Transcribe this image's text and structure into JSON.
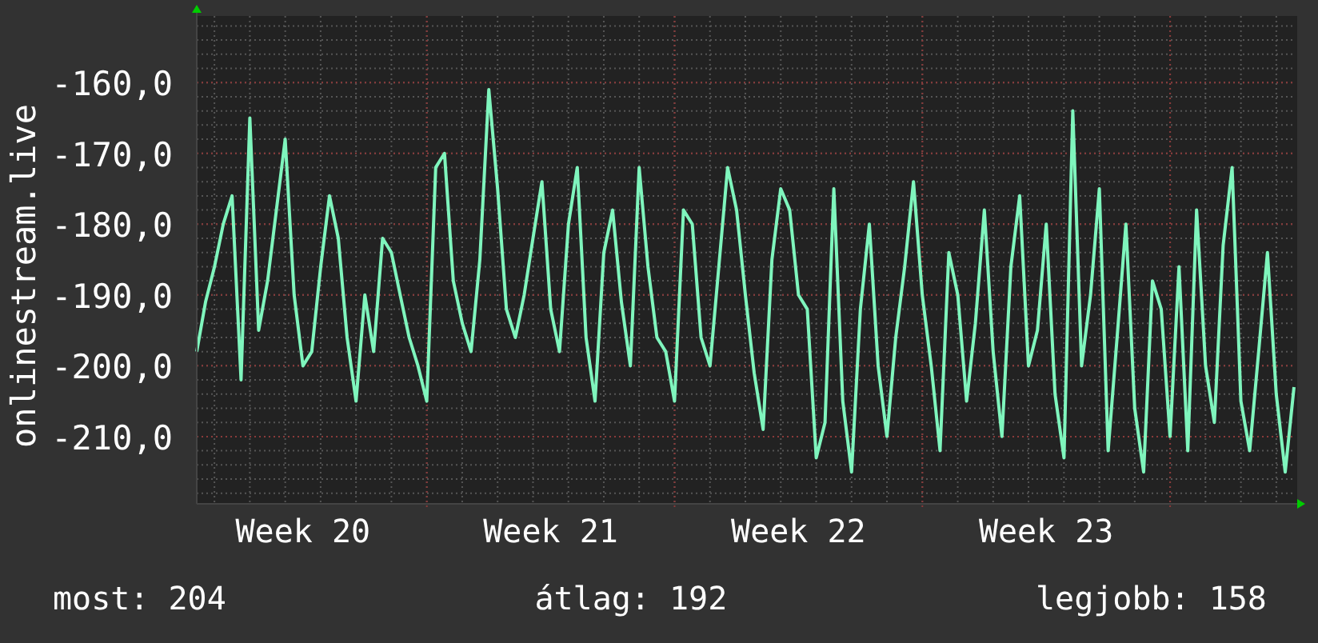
{
  "graph": {
    "chart_data": {
      "type": "line",
      "grid": true,
      "ylabel": "onlinestream.live",
      "ylim": [
        -219.5,
        -150.6
      ],
      "categories": [
        null,
        null,
        null,
        null,
        null,
        null,
        null,
        null,
        null,
        null,
        null,
        null,
        "Week 20",
        null,
        null,
        null,
        null,
        null,
        null,
        null,
        null,
        null,
        null,
        null,
        null,
        null,
        null,
        null,
        null,
        null,
        null,
        null,
        null,
        null,
        null,
        null,
        null,
        null,
        null,
        null,
        "Week 21",
        null,
        null,
        null,
        null,
        null,
        null,
        null,
        null,
        null,
        null,
        null,
        null,
        null,
        null,
        null,
        null,
        null,
        null,
        null,
        null,
        null,
        null,
        null,
        null,
        null,
        null,
        null,
        "Week 22",
        null,
        null,
        null,
        null,
        null,
        null,
        null,
        null,
        null,
        null,
        null,
        null,
        null,
        null,
        null,
        null,
        null,
        null,
        null,
        null,
        null,
        null,
        null,
        null,
        null,
        null,
        null,
        "Week 23",
        null,
        null,
        null,
        null,
        null,
        null,
        null,
        null,
        null,
        null,
        null,
        null,
        null,
        null,
        null,
        null,
        null,
        null,
        null,
        null,
        null,
        null,
        null,
        null,
        null,
        null,
        null,
        null
      ],
      "yticks": [
        {
          "value": -210,
          "label": "-210,0"
        },
        {
          "value": -200,
          "label": "-200,0"
        },
        {
          "value": -190,
          "label": "-190,0"
        },
        {
          "value": -180,
          "label": "-180,0"
        },
        {
          "value": -170,
          "label": "-170,0"
        },
        {
          "value": -160,
          "label": "-160,0"
        }
      ],
      "series": [
        {
          "color": "#7ff5bd",
          "values": [
            -198,
            -191,
            -186,
            -180,
            -176,
            -202,
            -165,
            -195,
            -188,
            -178,
            -168,
            -190,
            -200,
            -198,
            -186,
            -176,
            -182,
            -196,
            -205,
            -190,
            -198,
            -182,
            -184,
            -190,
            -196,
            -200,
            -205,
            -172,
            -170,
            -188,
            -194,
            -198,
            -185,
            -161,
            -175,
            -192,
            -196,
            -190,
            -182,
            -174,
            -192,
            -198,
            -180,
            -172,
            -196,
            -205,
            -184,
            -178,
            -191,
            -200,
            -172,
            -186,
            -196,
            -198,
            -205,
            -178,
            -180,
            -196,
            -200,
            -186,
            -172,
            -178,
            -190,
            -201,
            -209,
            -185,
            -175,
            -178,
            -190,
            -192,
            -213,
            -208,
            -175,
            -205,
            -215,
            -192,
            -180,
            -200,
            -210,
            -196,
            -186,
            -174,
            -190,
            -200,
            -212,
            -184,
            -190,
            -205,
            -194,
            -178,
            -198,
            -210,
            -186,
            -176,
            -200,
            -195,
            -180,
            -204,
            -213,
            -164,
            -200,
            -190,
            -175,
            -212,
            -196,
            -180,
            -206,
            -215,
            -188,
            -192,
            -210,
            -186,
            -212,
            -178,
            -200,
            -208,
            -183,
            -172,
            -205,
            -212,
            -198,
            -184,
            -204,
            -215,
            -203
          ]
        }
      ]
    }
  },
  "stats": [
    "most: 204",
    "átlag: 192",
    "legjobb: 158"
  ]
}
